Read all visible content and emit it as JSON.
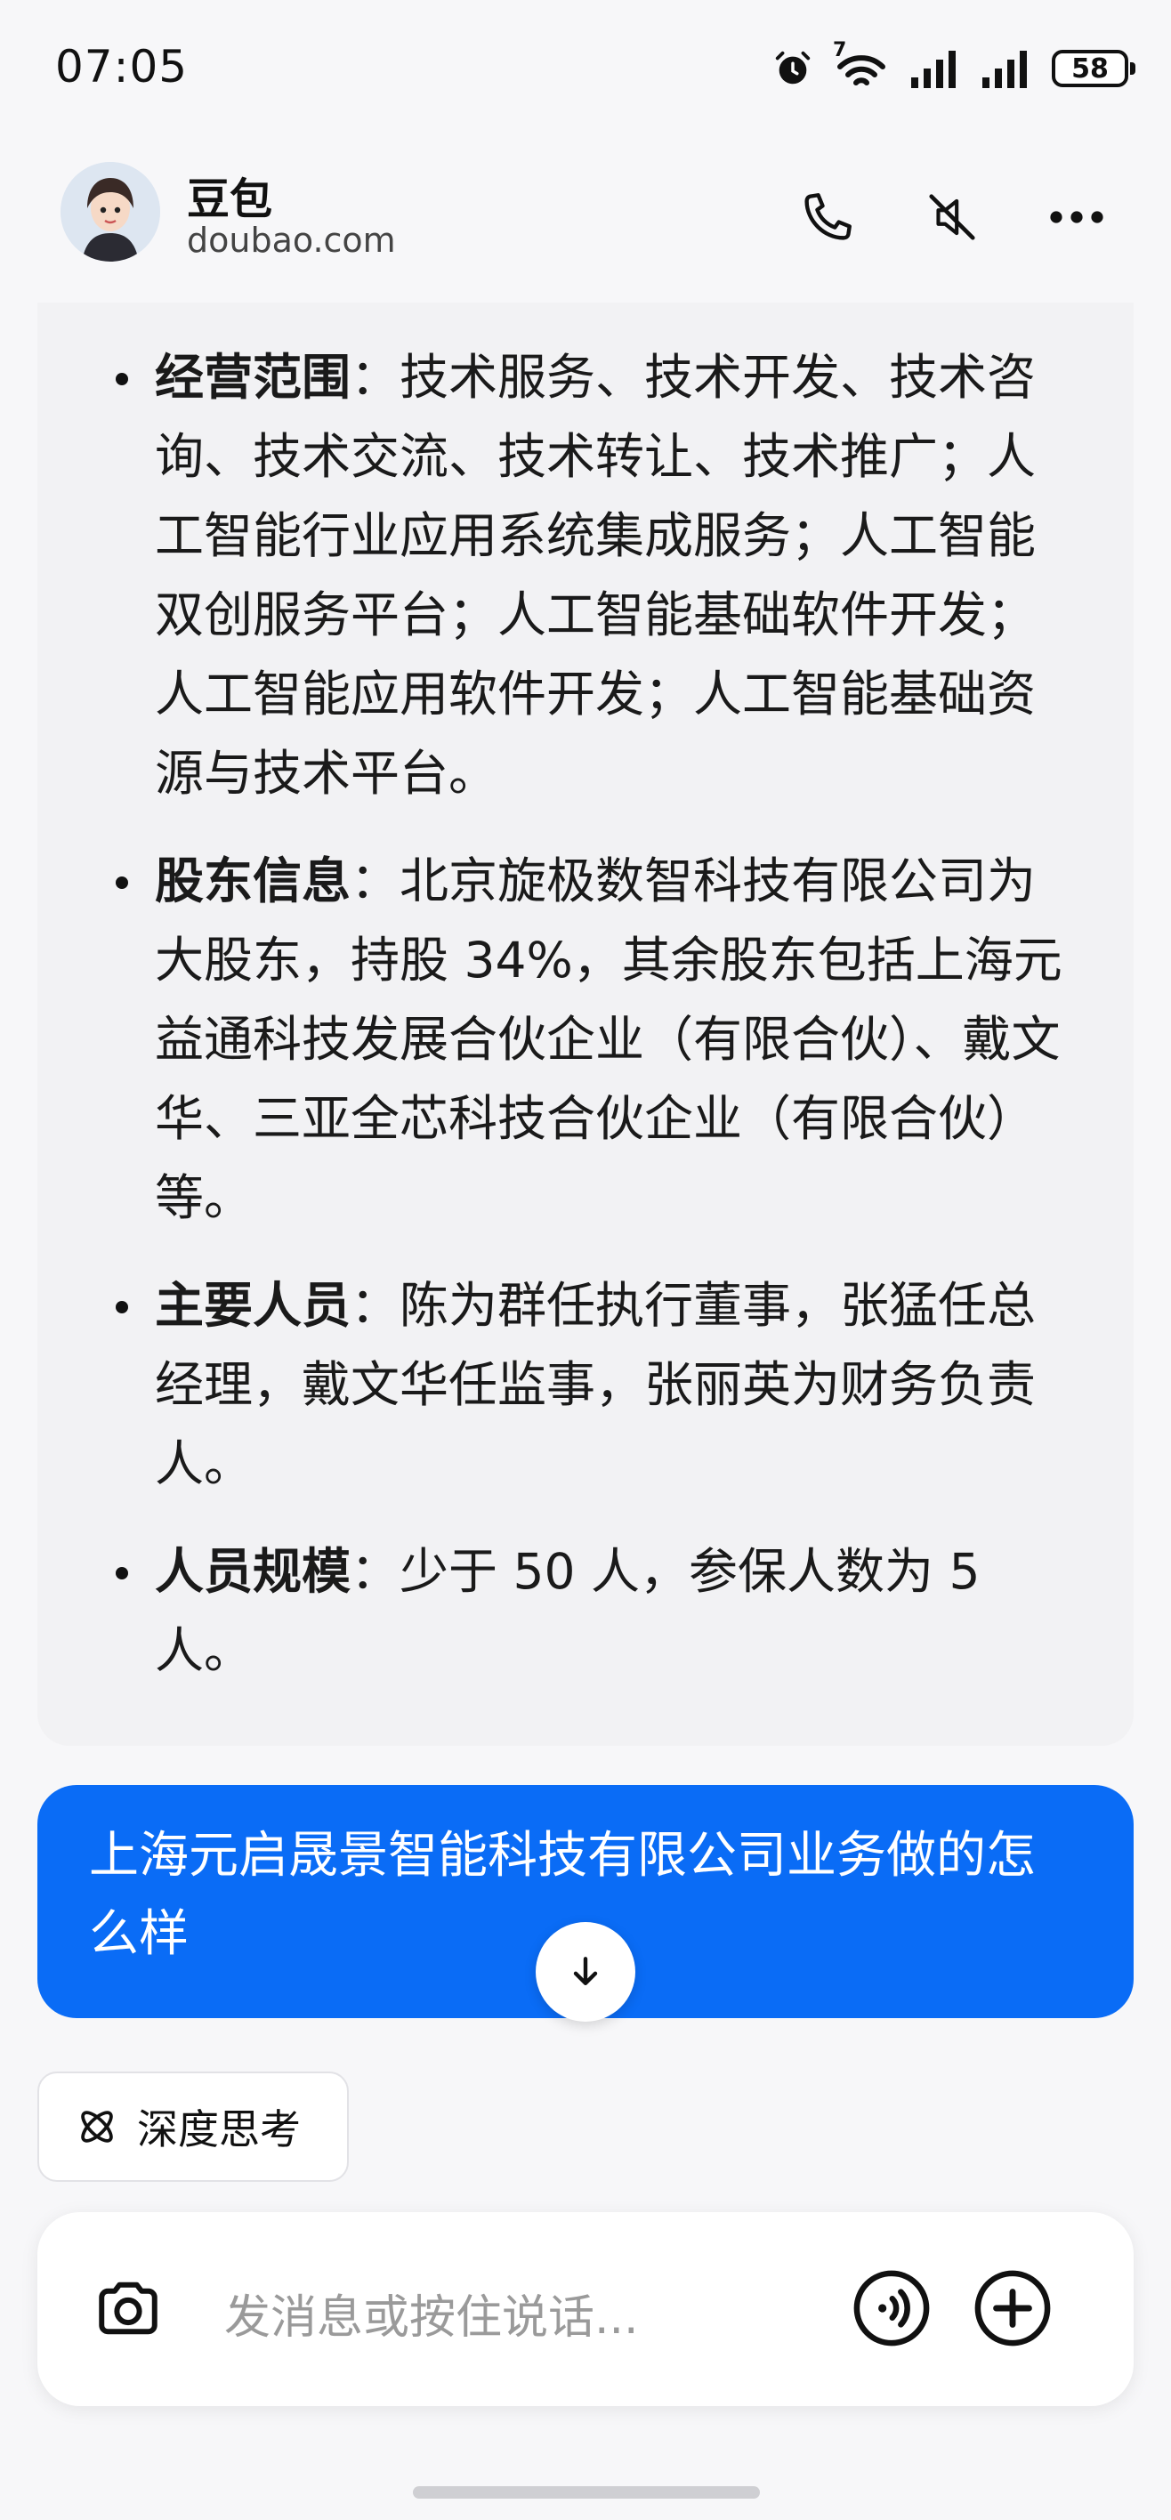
{
  "status": {
    "time": "07:05",
    "battery": "58",
    "network_badge": "7"
  },
  "header": {
    "name": "豆包",
    "domain": "doubao.com",
    "icons": [
      "phone-icon",
      "mute-icon",
      "more-icon"
    ]
  },
  "response": {
    "items": [
      {
        "label": "经营范围",
        "text": "：技术服务、技术开发、技术咨询、技术交流、技术转让、技术推广；人工智能行业应用系统集成服务；人工智能双创服务平台；人工智能基础软件开发；人工智能应用软件开发；人工智能基础资源与技术平台。"
      },
      {
        "label": "股东信息",
        "text": "：北京旋极数智科技有限公司为大股东，持股 34%，其余股东包括上海元益通科技发展合伙企业（有限合伙）、戴文华、三亚全芯科技合伙企业（有限合伙）等。"
      },
      {
        "label": "主要人员",
        "text": "：陈为群任执行董事，张猛任总经理，戴文华任监事，张丽英为财务负责人。"
      },
      {
        "label": "人员规模",
        "text": "：少于 50 人，参保人数为 5 人。"
      }
    ]
  },
  "user_message": "上海元启晟景智能科技有限公司业务做的怎么样",
  "deep_think_label": "深度思考",
  "composer": {
    "placeholder": "发消息或按住说话..."
  },
  "colors": {
    "accent": "#0a6cf6",
    "card_bg": "#f2f2f4"
  }
}
